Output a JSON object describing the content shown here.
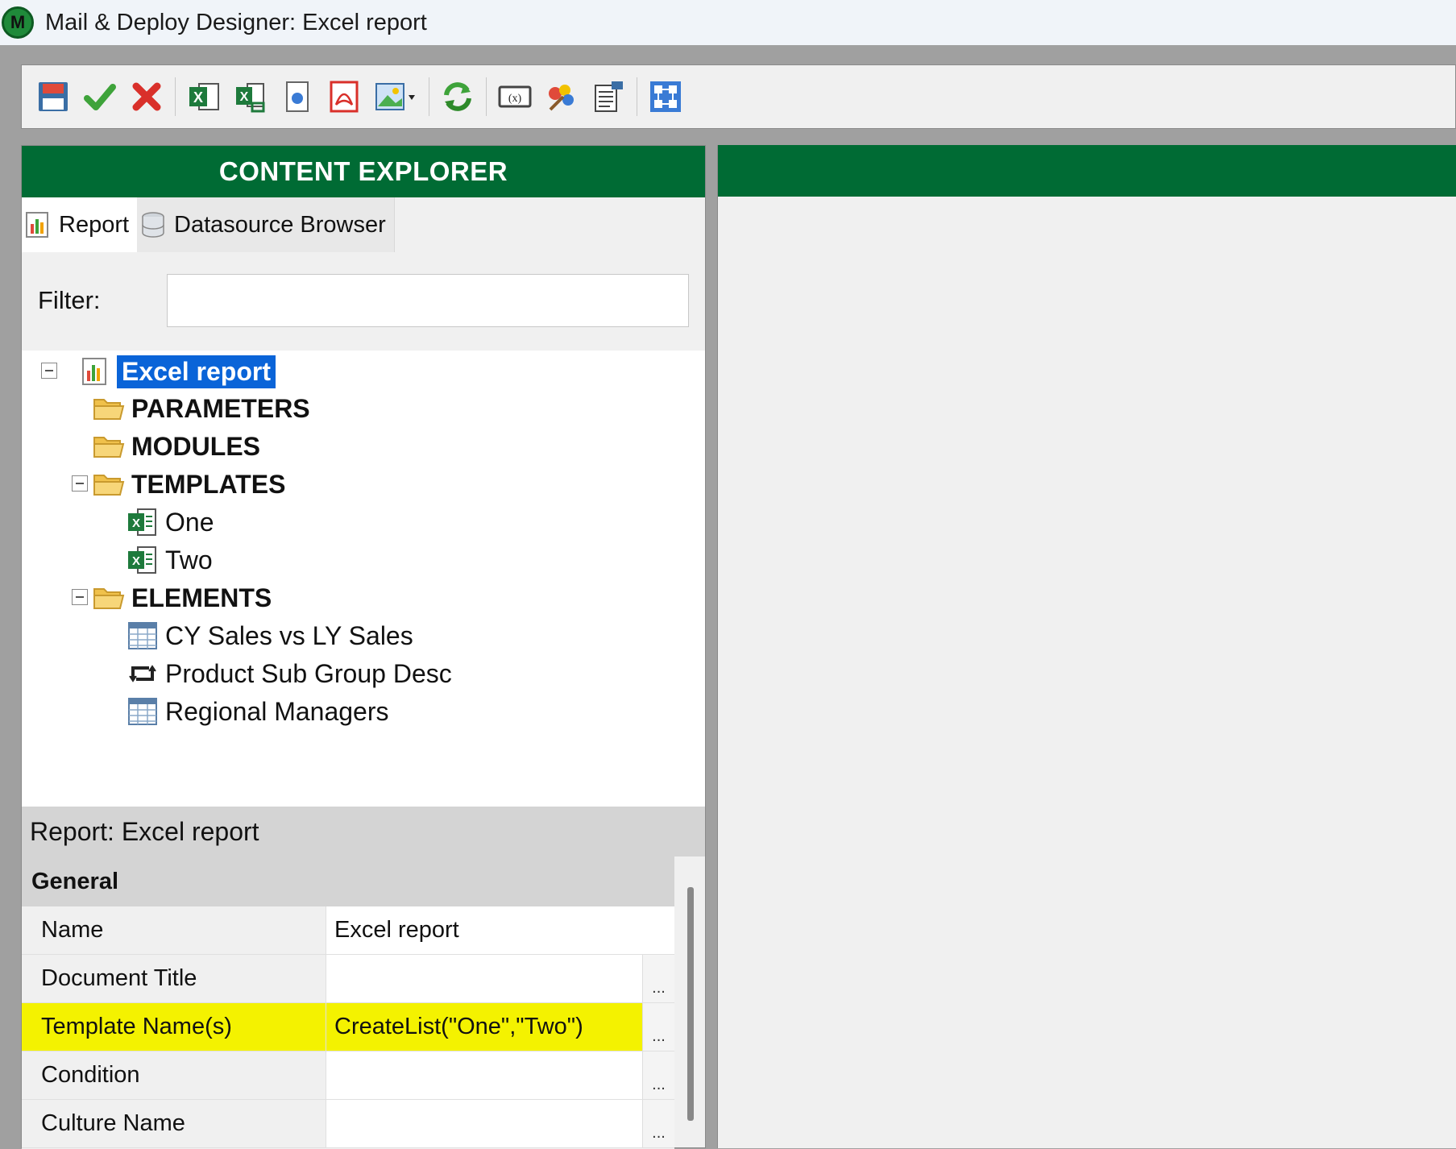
{
  "window": {
    "logo_letter": "M",
    "title": "Mail & Deploy Designer: Excel report"
  },
  "toolbar": {
    "buttons": [
      {
        "name": "save",
        "icon": "save-icon"
      },
      {
        "name": "apply",
        "icon": "checkmark-icon"
      },
      {
        "name": "cancel",
        "icon": "red-x-icon"
      },
      {
        "name": "excel",
        "icon": "excel-icon"
      },
      {
        "name": "excel-export",
        "icon": "excel-export-icon"
      },
      {
        "name": "document",
        "icon": "document-icon"
      },
      {
        "name": "pdf",
        "icon": "pdf-icon"
      },
      {
        "name": "image",
        "icon": "image-dropdown-icon"
      },
      {
        "name": "refresh",
        "icon": "refresh-icon"
      },
      {
        "name": "variable",
        "icon": "variable-icon"
      },
      {
        "name": "theme",
        "icon": "palette-icon"
      },
      {
        "name": "script",
        "icon": "vb-script-icon"
      },
      {
        "name": "model",
        "icon": "datamodel-icon"
      }
    ]
  },
  "content_explorer": {
    "header": "CONTENT EXPLORER",
    "tabs": [
      {
        "label": "Report",
        "icon": "report-icon"
      },
      {
        "label": "Datasource Browser",
        "icon": "database-icon"
      }
    ],
    "filter_label": "Filter:",
    "filter_value": "",
    "tree": {
      "root": "Excel report",
      "parameters": "PARAMETERS",
      "modules": "MODULES",
      "templates": "TEMPLATES",
      "template_items": [
        "One",
        "Two"
      ],
      "elements": "ELEMENTS",
      "element_items": [
        "CY Sales vs LY Sales",
        "Product Sub Group Desc",
        "Regional Managers"
      ]
    }
  },
  "properties": {
    "title": "Report: Excel report",
    "category": "General",
    "rows": [
      {
        "name": "Name",
        "value": "Excel report",
        "has_button": false
      },
      {
        "name": "Document Title",
        "value": "",
        "has_button": true
      },
      {
        "name": "Template Name(s)",
        "value": "CreateList(\"One\",\"Two\")",
        "has_button": true
      },
      {
        "name": "Condition",
        "value": "",
        "has_button": true
      },
      {
        "name": "Culture Name",
        "value": "",
        "has_button": true
      }
    ],
    "dots": "..."
  },
  "colors": {
    "header_green": "#006b34",
    "selection_blue": "#0a64d8",
    "highlight_yellow": "#f4f200"
  }
}
